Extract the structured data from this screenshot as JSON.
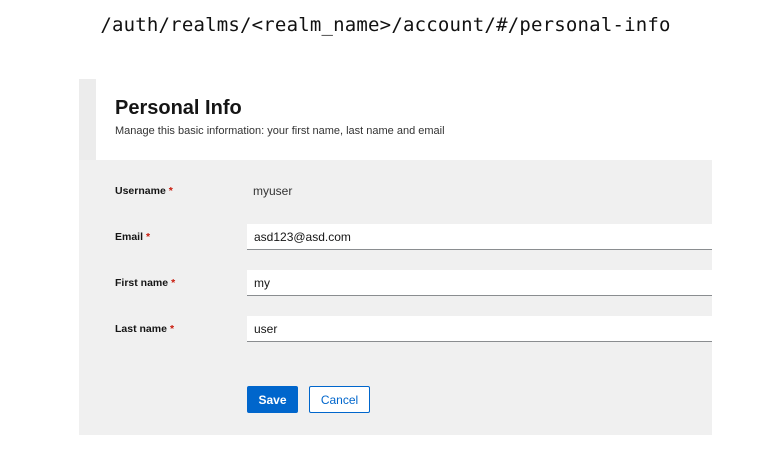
{
  "url_caption": "/auth/realms/<realm_name>/account/#/personal-info",
  "header": {
    "title": "Personal Info",
    "subtitle": "Manage this basic information: your first name, last name and email"
  },
  "form": {
    "required_marker": "*",
    "username": {
      "label": "Username",
      "value": "myuser"
    },
    "email": {
      "label": "Email",
      "value": "asd123@asd.com"
    },
    "first_name": {
      "label": "First name",
      "value": "my"
    },
    "last_name": {
      "label": "Last name",
      "value": "user"
    }
  },
  "actions": {
    "save_label": "Save",
    "cancel_label": "Cancel"
  },
  "colors": {
    "primary": "#0066cc",
    "required": "#c9190b",
    "panel_background": "#f0f0f0"
  }
}
